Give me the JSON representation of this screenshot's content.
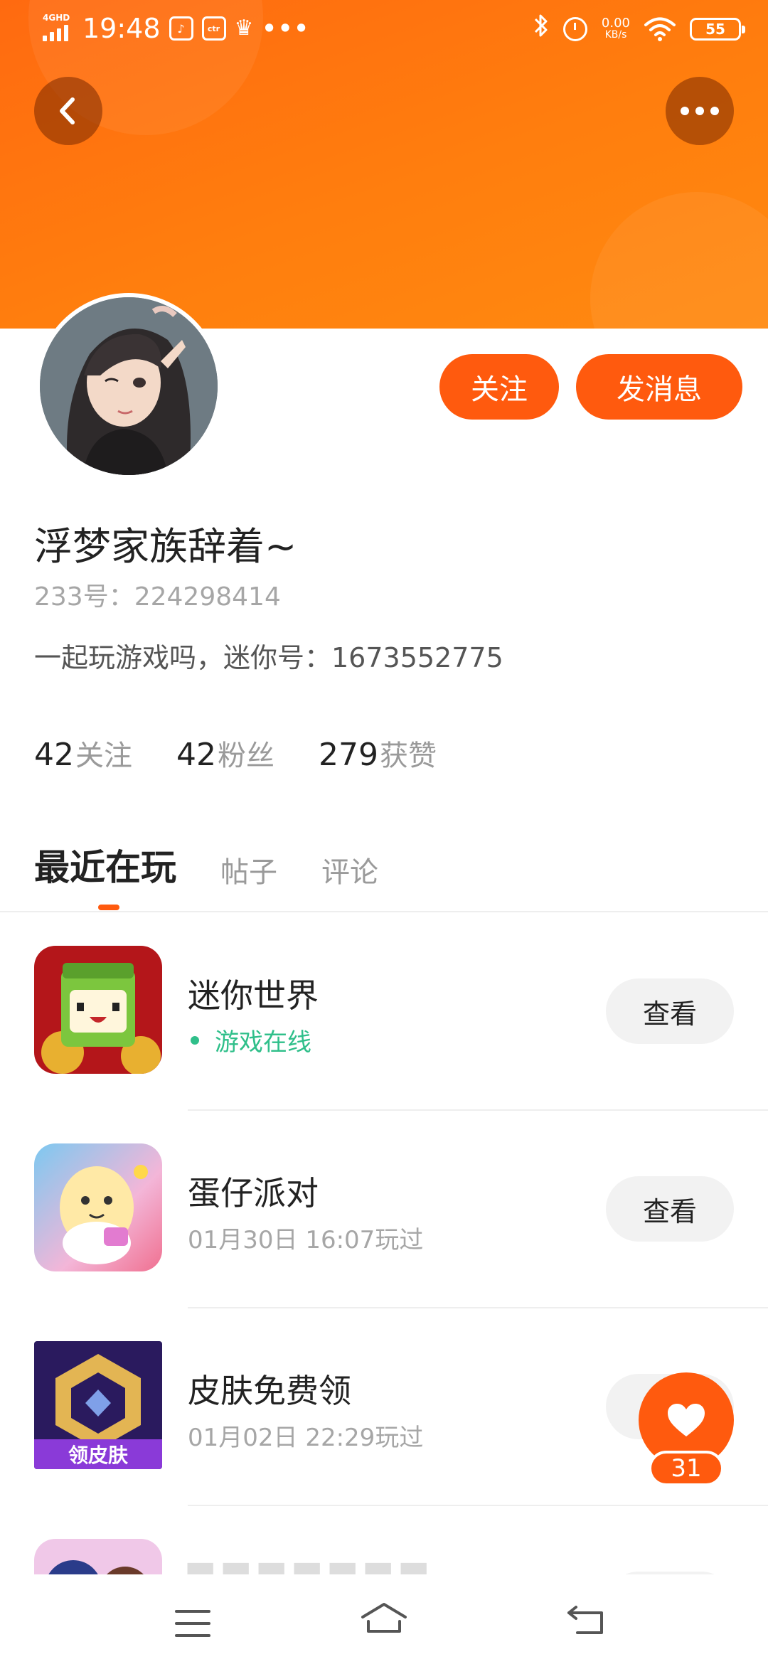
{
  "status_bar": {
    "network": "4GHD",
    "time": "19:48",
    "notif_icon_2": "ctr",
    "more": "•••",
    "net_speed": "0.00",
    "net_speed_unit": "KB/s",
    "battery": "55"
  },
  "profile": {
    "follow_label": "关注",
    "message_label": "发消息",
    "username": "浮梦家族辞着~",
    "account_id": "233号：224298414",
    "bio": "一起玩游戏吗，迷你号：1673552775"
  },
  "stats": [
    {
      "count": "42",
      "label": "关注"
    },
    {
      "count": "42",
      "label": "粉丝"
    },
    {
      "count": "279",
      "label": "获赞"
    }
  ],
  "tabs": [
    {
      "label": "最近在玩"
    },
    {
      "label": "帖子"
    },
    {
      "label": "评论"
    }
  ],
  "games": [
    {
      "name": "迷你世界",
      "status": "游戏在线",
      "button": "查看"
    },
    {
      "name": "蛋仔派对",
      "status": "01月30日 16:07玩过",
      "button": "查看"
    },
    {
      "name": "皮肤免费领",
      "status": "01月02日 22:29玩过",
      "button": "查看"
    }
  ],
  "icon_text": {
    "skin_badge": "领皮肤"
  },
  "like": {
    "count": "31"
  },
  "colors": {
    "accent": "#ff5a0e",
    "header": "#ff7a10",
    "online": "#2fbf8a"
  },
  "icons": {
    "back": "chevron-left-icon",
    "more": "more-dots-icon",
    "like": "heart-icon",
    "nav": [
      "menu-icon",
      "home-icon",
      "back-icon"
    ]
  }
}
